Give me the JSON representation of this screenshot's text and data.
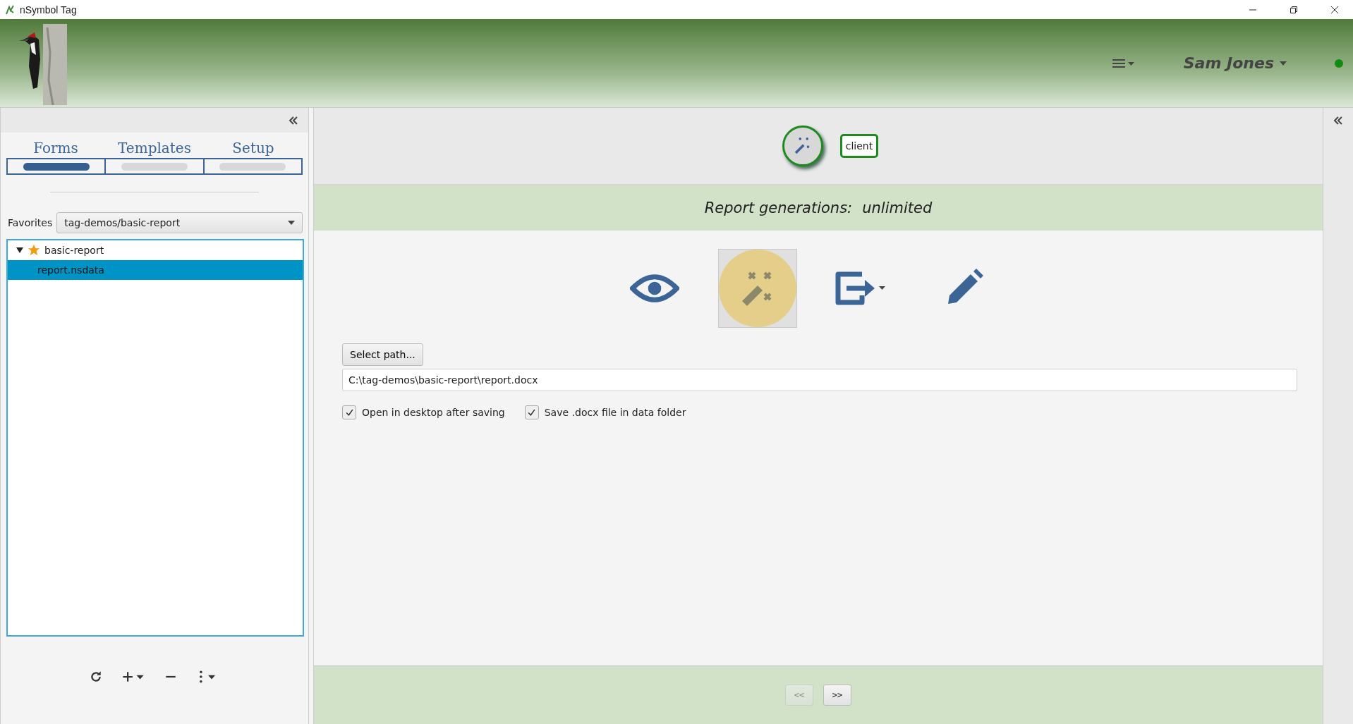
{
  "window": {
    "title": "nSymbol Tag"
  },
  "header": {
    "user": "Sam Jones",
    "online": true
  },
  "sidebar": {
    "tabs": [
      {
        "label": "Forms",
        "selected": true
      },
      {
        "label": "Templates",
        "selected": false
      },
      {
        "label": "Setup",
        "selected": false
      }
    ],
    "favorites": {
      "label": "Favorites",
      "value": "tag-demos/basic-report"
    },
    "tree": [
      {
        "label": "basic-report",
        "expanded": true,
        "favorite": true,
        "selected": false,
        "children": [
          {
            "label": "report.nsdata",
            "selected": true
          }
        ]
      }
    ]
  },
  "main": {
    "mode_tag": "client",
    "generations": {
      "label": "Report generations:",
      "value": "unlimited"
    },
    "actions": [
      {
        "kind": "preview",
        "selected": false
      },
      {
        "kind": "generate",
        "selected": true
      },
      {
        "kind": "export",
        "selected": false
      },
      {
        "kind": "edit",
        "selected": false
      }
    ],
    "select_path": "Select path...",
    "path": "C:\\tag-demos\\basic-report\\report.docx",
    "options": [
      {
        "label": "Open in desktop after saving",
        "checked": true
      },
      {
        "label": "Save .docx file in data folder",
        "checked": true
      }
    ],
    "nav": [
      {
        "label": "<<",
        "disabled": true
      },
      {
        "label": ">>",
        "disabled": false
      }
    ]
  }
}
